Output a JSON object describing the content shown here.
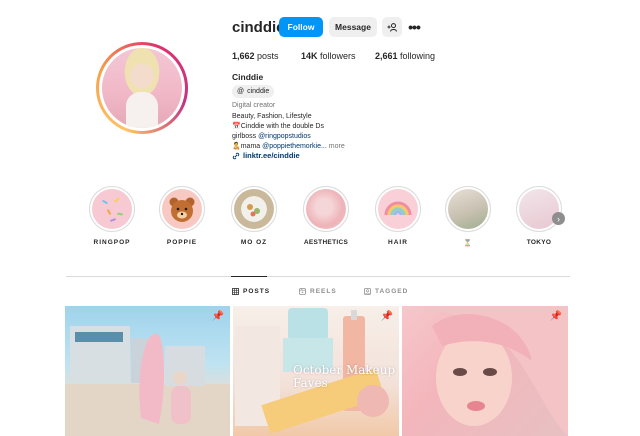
{
  "profile": {
    "username": "cinddie",
    "buttons": {
      "follow": "Follow",
      "message": "Message"
    },
    "more_glyph": "•••",
    "stats": {
      "posts": "1,662",
      "posts_label": "posts",
      "followers": "14K",
      "followers_label": "followers",
      "following": "2,661",
      "following_label": "following"
    },
    "full_name": "Cinddie",
    "threads_handle": "cinddie",
    "category": "Digital creator",
    "bio": {
      "line1": "Beauty, Fashion, Lifestyle",
      "line2": "📅Cinddie with the double Ds",
      "line3_text": "girlboss ",
      "line3_mention": "@ringpopstudios",
      "line4_text": "🧑‍🍼mama ",
      "line4_mention": "@poppiethemorkie...",
      "more": "more"
    },
    "link": "linktr.ee/cinddie"
  },
  "highlights": [
    {
      "label": "RINGPOP",
      "icon": "sprinkles-icon"
    },
    {
      "label": "POPPIE",
      "icon": "bear-icon"
    },
    {
      "label": "MO OZ",
      "icon": "food-icon"
    },
    {
      "label": "AESTHETICS",
      "icon": "pink-icon"
    },
    {
      "label": "HAIR",
      "icon": "rainbow-icon"
    },
    {
      "label": "⏳",
      "icon": "room-icon"
    },
    {
      "label": "TOKYO",
      "icon": "tokyo-icon"
    }
  ],
  "tabs": [
    {
      "label": "POSTS",
      "icon": "grid-icon",
      "active": true
    },
    {
      "label": "REELS",
      "icon": "reels-icon",
      "active": false
    },
    {
      "label": "TAGGED",
      "icon": "tagged-icon",
      "active": false
    }
  ],
  "posts": [
    {
      "pinned": true,
      "caption": ""
    },
    {
      "pinned": true,
      "caption": "October Makeup Faves"
    },
    {
      "pinned": true,
      "caption": ""
    }
  ],
  "colors": {
    "accent": "#0095f6",
    "link": "#00376b"
  }
}
